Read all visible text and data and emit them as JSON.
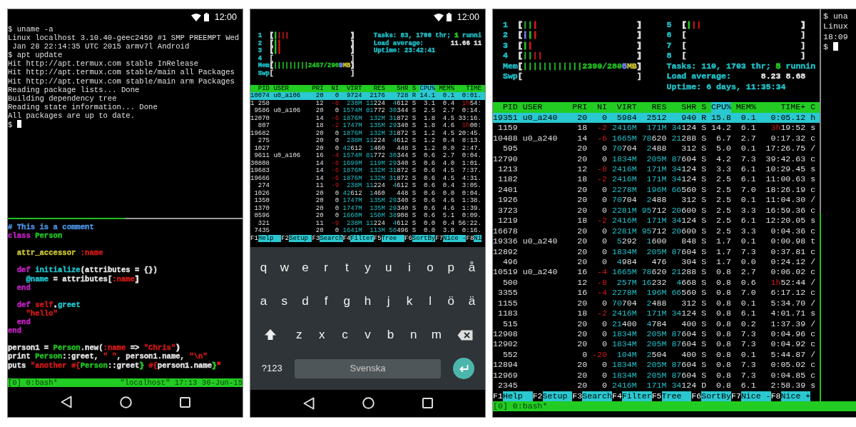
{
  "left_phone": {
    "status_bar": {
      "time": "12:00"
    },
    "shell": {
      "lines": [
        "$ uname -a",
        "Linux localhost 3.10.40-geec2459 #1 SMP PREEMPT Wed",
        " Jan 28 22:14:35 UTC 2015 armv7l Android",
        "$ apt update",
        "Hit http://apt.termux.com stable InRelease",
        "Hit http://apt.termux.com stable/main all Packages",
        "Hit http://apt.termux.com stable/main arm Packages",
        "Reading package lists... Done",
        "Building dependency tree",
        "Reading state information... Done",
        "All packages are up to date."
      ],
      "prompt": "$",
      "cursor": true
    },
    "code": [
      {
        "segments": [
          {
            "text": "# This is a comment",
            "color": "#4a90e0"
          }
        ]
      },
      {
        "segments": [
          {
            "text": "class",
            "color": "#c020c0"
          },
          {
            "text": " Person",
            "color": "#22c022"
          }
        ]
      },
      {
        "space_before": true,
        "segments": [
          {
            "text": "  attr_accessor",
            "color": "#c8c030"
          },
          {
            "text": " :name",
            "color": "#d01818"
          }
        ]
      },
      {
        "space_before": true,
        "segments": [
          {
            "text": "  def",
            "color": "#c020c0"
          },
          {
            "text": " initialize",
            "color": "#20c0c8"
          },
          {
            "text": "(attributes = {})",
            "color": "#e0e0e0"
          }
        ]
      },
      {
        "segments": [
          {
            "text": "    @name",
            "color": "#20c0c8"
          },
          {
            "text": " = attributes[",
            "color": "#e0e0e0"
          },
          {
            "text": ":name",
            "color": "#d01818"
          },
          {
            "text": "]",
            "color": "#e0e0e0"
          }
        ]
      },
      {
        "segments": [
          {
            "text": "  end",
            "color": "#c020c0"
          }
        ]
      },
      {
        "space_before": true,
        "segments": [
          {
            "text": "  def",
            "color": "#c020c0"
          },
          {
            "text": " self",
            "color": "#d01818"
          },
          {
            "text": ".",
            "color": "#e0e0e0"
          },
          {
            "text": "greet",
            "color": "#20c0c8"
          }
        ]
      },
      {
        "segments": [
          {
            "text": "    \"hello\"",
            "color": "#d01818"
          }
        ]
      },
      {
        "segments": [
          {
            "text": "  end",
            "color": "#c020c0"
          }
        ]
      },
      {
        "segments": [
          {
            "text": "end",
            "color": "#c020c0"
          }
        ]
      },
      {
        "space_before": true,
        "segments": [
          {
            "text": "person1 = ",
            "color": "#e0e0e0"
          },
          {
            "text": "Person",
            "color": "#22c022"
          },
          {
            "text": ".new(",
            "color": "#e0e0e0"
          },
          {
            "text": ":name",
            "color": "#d01818"
          },
          {
            "text": " => ",
            "color": "#e0e0e0"
          },
          {
            "text": "\"Chris\"",
            "color": "#d01818"
          },
          {
            "text": ")",
            "color": "#e0e0e0"
          }
        ]
      },
      {
        "segments": [
          {
            "text": "print ",
            "color": "#e0e0e0"
          },
          {
            "text": "Person",
            "color": "#22c022"
          },
          {
            "text": "::greet, ",
            "color": "#e0e0e0"
          },
          {
            "text": "\" \"",
            "color": "#d01818"
          },
          {
            "text": ", person1.name, ",
            "color": "#e0e0e0"
          },
          {
            "text": "\"\\n\"",
            "color": "#d01818"
          }
        ]
      },
      {
        "segments": [
          {
            "text": "puts ",
            "color": "#e0e0e0"
          },
          {
            "text": "\"another #{",
            "color": "#d01818"
          },
          {
            "text": "Person",
            "color": "#22c022"
          },
          {
            "text": "::greet",
            "color": "#e0e0e0"
          },
          {
            "text": "}",
            "color": "#22c022"
          },
          {
            "text": " #{",
            "color": "#d01818"
          },
          {
            "text": "person1.name",
            "color": "#e0e0e0"
          },
          {
            "text": "}",
            "color": "#22c022"
          },
          {
            "text": "\"",
            "color": "#d01818"
          }
        ]
      }
    ],
    "tmux_status": {
      "left": "[0] 0:bash*",
      "right": "\"localhost\" 17:13 30-Jun-15"
    }
  },
  "middle_phone": {
    "status_bar": {
      "time": "12:00"
    },
    "htop": {
      "meters_left": [
        {
          "segments": [
            {
              "text": "  1  ",
              "color": "#20c0c8"
            },
            {
              "text": "[",
              "color": "#e0e0e0"
            },
            {
              "text": "|",
              "color": "#22c022"
            },
            {
              "text": "|||",
              "color": "#d01818"
            },
            {
              "text": "                ]",
              "color": "#e0e0e0"
            }
          ]
        },
        {
          "segments": [
            {
              "text": "  2  ",
              "color": "#20c0c8"
            },
            {
              "text": "[",
              "color": "#e0e0e0"
            },
            {
              "text": "|",
              "color": "#22c022"
            },
            {
              "text": "|",
              "color": "#d01818"
            },
            {
              "text": "                  ]",
              "color": "#e0e0e0"
            }
          ]
        },
        {
          "segments": [
            {
              "text": "  3  ",
              "color": "#20c0c8"
            },
            {
              "text": "[",
              "color": "#e0e0e0"
            },
            {
              "text": "|",
              "color": "#22c022"
            },
            {
              "text": "|",
              "color": "#d01818"
            },
            {
              "text": "                  ]",
              "color": "#e0e0e0"
            }
          ]
        },
        {
          "segments": [
            {
              "text": "  4  ",
              "color": "#20c0c8"
            },
            {
              "text": "[                    ]",
              "color": "#e0e0e0"
            }
          ]
        },
        {
          "segments": [
            {
              "text": "  Mem",
              "color": "#20c0c8"
            },
            {
              "text": "[",
              "color": "#e0e0e0"
            },
            {
              "text": "|||||||||2457/296",
              "color": "#22c022"
            },
            {
              "text": "9",
              "color": "#6a7ae0"
            },
            {
              "text": "MB",
              "color": "#c8c030"
            },
            {
              "text": "]",
              "color": "#e0e0e0"
            }
          ]
        },
        {
          "segments": [
            {
              "text": "  Swp",
              "color": "#20c0c8"
            },
            {
              "text": "[                    ]",
              "color": "#e0e0e0"
            }
          ]
        }
      ],
      "meters_right": [
        {
          "segments": [
            {
              "text": "Tasks: 83, 1700 thr; ",
              "color": "#20c0c8"
            },
            {
              "text": "1",
              "color": "#22c022"
            },
            {
              "text": " runni",
              "color": "#20c0c8"
            }
          ]
        },
        {
          "segments": [
            {
              "text": "Load average: ",
              "color": "#20c0c8"
            },
            {
              "text": "      11.66 11",
              "color": "#e0e0e0"
            }
          ]
        },
        {
          "segments": [
            {
              "text": "Uptime: 23:42:41",
              "color": "#20c0c8"
            }
          ]
        }
      ],
      "columns": [
        {
          "text": "PID",
          "sorted": false
        },
        {
          "text": "USER",
          "sorted": false
        },
        {
          "text": "PRI",
          "sorted": false
        },
        {
          "text": "NI",
          "sorted": false
        },
        {
          "text": "VIRT",
          "sorted": false
        },
        {
          "text": "RES",
          "sorted": false
        },
        {
          "text": "SHR",
          "sorted": false
        },
        {
          "text": "S",
          "sorted": false
        },
        {
          "text": "CPU%",
          "sorted": true
        },
        {
          "text": "MEM%",
          "sorted": false
        },
        {
          "text": "TIME",
          "sorted": false
        }
      ],
      "rows": [
        {
          "selected": true,
          "pid": "10074",
          "user": "u0_a106",
          "pri": "20",
          "ni": "0",
          "virt": "9724",
          "res": "2176",
          "shr": "728",
          "state": "R",
          "cpu": "14.1",
          "mem": "0.1",
          "time": "0:01."
        },
        {
          "selected": false,
          "pid": "1 258",
          "pri": "12",
          "ni": {
            "alert": "-8"
          },
          "virt": {
            "hi": "238M"
          },
          "res": {
            "hi": "11",
            "text": "224"
          },
          "shr": {
            "hi": "4",
            "text": "612"
          },
          "state": "S",
          "cpu": "3.1",
          "mem": "0.4",
          "time": {
            "alert": "1h",
            "text": "54:"
          }
        },
        {
          "selected": false,
          "pid": "9586",
          "user": "u0_a106",
          "pri": "20",
          "ni": "0",
          "virt": {
            "hi": "1574M"
          },
          "res": {
            "hi": "81",
            "text": "772"
          },
          "shr": {
            "hi": "30",
            "text": "344"
          },
          "state": "S",
          "cpu": "2.5",
          "mem": "2.7",
          "time": "0:14."
        },
        {
          "selected": false,
          "pid": "12070",
          "pri": "14",
          "ni": {
            "alert": "-6"
          },
          "virt": {
            "hi": "1876M"
          },
          "res": {
            "hi": "132M"
          },
          "shr": {
            "hi": "31",
            "text": "872"
          },
          "state": "S",
          "cpu": "1.8",
          "mem": "4.5",
          "time": "33:16."
        },
        {
          "selected": false,
          "pid": "807",
          "pri": "18",
          "ni": {
            "alert": "-2"
          },
          "virt": {
            "hi": "1747M"
          },
          "res": {
            "hi": "135M"
          },
          "shr": {
            "hi": "29",
            "text": "340"
          },
          "state": "S",
          "cpu": "1.8",
          "mem": "4.6",
          "time": {
            "alert": "1h",
            "text": "00:"
          }
        },
        {
          "selected": false,
          "pid": "19682",
          "pri": "20",
          "ni": "0",
          "virt": {
            "hi": "1876M"
          },
          "res": {
            "hi": "132M"
          },
          "shr": {
            "hi": "31",
            "text": "872"
          },
          "state": "S",
          "cpu": "1.2",
          "mem": "4.5",
          "time": "20:45."
        },
        {
          "selected": false,
          "pid": "275",
          "pri": "20",
          "ni": "0",
          "virt": {
            "hi": "238M"
          },
          "res": {
            "hi": "11",
            "text": "224"
          },
          "shr": {
            "hi": "4",
            "text": "612"
          },
          "state": "S",
          "cpu": "1.2",
          "mem": "0.4",
          "time": "8:13."
        },
        {
          "selected": false,
          "pid": "1027",
          "pri": "20",
          "ni": "0",
          "virt": {
            "hi": "42",
            "text": "612"
          },
          "res": {
            "hi": "1",
            "text": "460"
          },
          "shr": "448",
          "state": "S",
          "cpu": "1.2",
          "mem": "0.0",
          "time": "2:47."
        },
        {
          "selected": false,
          "pid": "9611",
          "user": "u0_a106",
          "pri": "16",
          "ni": {
            "alert": "-4"
          },
          "virt": {
            "hi": "1574M"
          },
          "res": {
            "hi": "81",
            "text": "772"
          },
          "shr": {
            "hi": "30",
            "text": "344"
          },
          "state": "S",
          "cpu": "0.6",
          "mem": "2.7",
          "time": "0:04."
        },
        {
          "selected": false,
          "pid": "30808",
          "pri": "14",
          "ni": {
            "alert": "-6"
          },
          "virt": {
            "hi": "1699M"
          },
          "res": {
            "hi": "119M"
          },
          "shr": {
            "hi": "29",
            "text": "340"
          },
          "state": "S",
          "cpu": "0.6",
          "mem": "4.0",
          "time": "1:01."
        },
        {
          "selected": false,
          "pid": "19683",
          "pri": "14",
          "ni": {
            "alert": "-6"
          },
          "virt": {
            "hi": "1876M"
          },
          "res": {
            "hi": "132M"
          },
          "shr": {
            "hi": "31",
            "text": "872"
          },
          "state": "S",
          "cpu": "0.6",
          "mem": "4.5",
          "time": "7:37."
        },
        {
          "selected": false,
          "pid": "19666",
          "pri": "14",
          "ni": {
            "alert": "-6"
          },
          "virt": {
            "hi": "1876M"
          },
          "res": {
            "hi": "132M"
          },
          "shr": {
            "hi": "31",
            "text": "872"
          },
          "state": "S",
          "cpu": "0.6",
          "mem": "4.5",
          "time": "4:31."
        },
        {
          "selected": false,
          "pid": "274",
          "pri": "11",
          "ni": {
            "alert": "-9"
          },
          "virt": {
            "hi": "238M"
          },
          "res": {
            "hi": "11",
            "text": "224"
          },
          "shr": {
            "hi": "4",
            "text": "612"
          },
          "state": "S",
          "cpu": "0.6",
          "mem": "0.4",
          "time": "3:05."
        },
        {
          "selected": false,
          "pid": "1026",
          "pri": "20",
          "ni": "0",
          "virt": {
            "hi": "42",
            "text": "612"
          },
          "res": {
            "hi": "1",
            "text": "460"
          },
          "shr": "448",
          "state": "S",
          "cpu": "0.6",
          "mem": "0.0",
          "time": "0:04."
        },
        {
          "selected": false,
          "pid": "1350",
          "pri": "20",
          "ni": "0",
          "virt": {
            "hi": "1747M"
          },
          "res": {
            "hi": "135M"
          },
          "shr": {
            "hi": "29",
            "text": "340"
          },
          "state": "S",
          "cpu": "0.6",
          "mem": "4.6",
          "time": "1:38."
        },
        {
          "selected": false,
          "pid": "1370",
          "pri": "20",
          "ni": "0",
          "virt": {
            "hi": "1747M"
          },
          "res": {
            "hi": "135M"
          },
          "shr": {
            "hi": "29",
            "text": "340"
          },
          "state": "S",
          "cpu": "0.6",
          "mem": "4.6",
          "time": "1:39."
        },
        {
          "selected": false,
          "pid": "8596",
          "pri": "20",
          "ni": "0",
          "virt": {
            "hi": "1660M"
          },
          "res": {
            "hi": "150M"
          },
          "shr": {
            "hi": "38",
            "text": "908"
          },
          "state": "S",
          "cpu": "0.6",
          "mem": "5.1",
          "time": "0:09."
        },
        {
          "selected": false,
          "pid": "321",
          "pri": "11",
          "ni": {
            "alert": "-9"
          },
          "virt": {
            "hi": "238M"
          },
          "res": {
            "hi": "11",
            "text": "224"
          },
          "shr": {
            "hi": "4",
            "text": "612"
          },
          "state": "S",
          "cpu": "0.0",
          "mem": "0.4",
          "time": "56:22."
        },
        {
          "selected": false,
          "pid": "7435",
          "pri": "20",
          "ni": "0",
          "virt": {
            "hi": "1641M"
          },
          "res": {
            "hi": "113M"
          },
          "shr": {
            "hi": "50",
            "text": "496"
          },
          "state": "S",
          "cpu": "0.0",
          "mem": "3.8",
          "time": "0:16."
        }
      ],
      "function_keys": [
        {
          "key": "F1",
          "label": "Help"
        },
        {
          "key": "F2",
          "label": "Setup"
        },
        {
          "key": "F3",
          "label": "Search"
        },
        {
          "key": "F4",
          "label": "Filter"
        },
        {
          "key": "F5",
          "label": "Tree"
        },
        {
          "key": "F6",
          "label": "SortBy"
        },
        {
          "key": "F7",
          "label": "Nice -"
        },
        {
          "key": "F8",
          "label": "Ni"
        }
      ]
    },
    "keyboard": {
      "letter_rows": [
        [
          "q",
          "w",
          "e",
          "r",
          "t",
          "y",
          "u",
          "i",
          "o",
          "p",
          "å"
        ],
        [
          "a",
          "s",
          "d",
          "f",
          "g",
          "h",
          "j",
          "k",
          "l",
          "ö",
          "ä"
        ],
        [
          "z",
          "x",
          "c",
          "v",
          "b",
          "n",
          "m"
        ]
      ],
      "mode_key": "?123",
      "space_label": "Svenska"
    }
  },
  "right_terminal": {
    "htop": {
      "meters_left": [
        {
          "segments": [
            {
              "text": "  1  ",
              "color": "#20c0c8"
            },
            {
              "text": "[",
              "color": "#e0e0e0"
            },
            {
              "text": "||",
              "color": "#22c022"
            },
            {
              "text": "|",
              "color": "#d01818"
            },
            {
              "text": "                    ]",
              "color": "#e0e0e0"
            }
          ]
        },
        {
          "segments": [
            {
              "text": "  2  ",
              "color": "#20c0c8"
            },
            {
              "text": "[",
              "color": "#e0e0e0"
            },
            {
              "text": "|",
              "color": "#6a7ae0"
            },
            {
              "text": "|",
              "color": "#22c022"
            },
            {
              "text": "|",
              "color": "#d01818"
            },
            {
              "text": "                    ]",
              "color": "#e0e0e0"
            }
          ]
        },
        {
          "segments": [
            {
              "text": "  3  ",
              "color": "#20c0c8"
            },
            {
              "text": "[",
              "color": "#e0e0e0"
            },
            {
              "text": "|",
              "color": "#22c022"
            },
            {
              "text": "|",
              "color": "#d01818"
            },
            {
              "text": "                     ]",
              "color": "#e0e0e0"
            }
          ]
        },
        {
          "segments": [
            {
              "text": "  4  ",
              "color": "#20c0c8"
            },
            {
              "text": "[",
              "color": "#e0e0e0"
            },
            {
              "text": "||",
              "color": "#22c022"
            },
            {
              "text": "||",
              "color": "#d01818"
            },
            {
              "text": "                   ]",
              "color": "#e0e0e0"
            }
          ]
        },
        {
          "segments": [
            {
              "text": "  Mem",
              "color": "#20c0c8"
            },
            {
              "text": "[",
              "color": "#e0e0e0"
            },
            {
              "text": "||||||||||||2390/280",
              "color": "#22c022"
            },
            {
              "text": "5",
              "color": "#6a7ae0"
            },
            {
              "text": "MB",
              "color": "#c8c030"
            },
            {
              "text": "]",
              "color": "#e0e0e0"
            }
          ]
        },
        {
          "segments": [
            {
              "text": "  Swp",
              "color": "#20c0c8"
            },
            {
              "text": "[                       ]",
              "color": "#e0e0e0"
            }
          ]
        }
      ],
      "meters_right": [
        {
          "segments": [
            {
              "text": "5  ",
              "color": "#20c0c8"
            },
            {
              "text": "[",
              "color": "#e0e0e0"
            },
            {
              "text": "|",
              "color": "#22c022"
            },
            {
              "text": "||",
              "color": "#d01818"
            },
            {
              "text": "                    ]",
              "color": "#e0e0e0"
            }
          ]
        },
        {
          "segments": [
            {
              "text": "6  ",
              "color": "#20c0c8"
            },
            {
              "text": "[                       ]",
              "color": "#e0e0e0"
            }
          ]
        },
        {
          "segments": [
            {
              "text": "7  ",
              "color": "#20c0c8"
            },
            {
              "text": "[                       ]",
              "color": "#e0e0e0"
            }
          ]
        },
        {
          "segments": [
            {
              "text": "8  ",
              "color": "#20c0c8"
            },
            {
              "text": "[                       ]",
              "color": "#e0e0e0"
            }
          ]
        },
        {
          "segments": [
            {
              "text": "Tasks: 110, 1703 thr; ",
              "color": "#20c0c8"
            },
            {
              "text": "5",
              "color": "#22c022"
            },
            {
              "text": " runnin",
              "color": "#20c0c8"
            }
          ]
        },
        {
          "segments": [
            {
              "text": "Load average: ",
              "color": "#20c0c8"
            },
            {
              "text": "     8.23 8.68",
              "color": "#e0e0e0"
            }
          ]
        },
        {
          "segments": [
            {
              "text": "Uptime: 6 days, 11:35:34",
              "color": "#20c0c8"
            }
          ]
        }
      ],
      "columns": [
        {
          "text": "PID",
          "sorted": false
        },
        {
          "text": "USER",
          "sorted": false
        },
        {
          "text": "PRI",
          "sorted": false
        },
        {
          "text": "NI",
          "sorted": false
        },
        {
          "text": "VIRT",
          "sorted": false
        },
        {
          "text": "RES",
          "sorted": false
        },
        {
          "text": "SHR",
          "sorted": false
        },
        {
          "text": "S",
          "sorted": false
        },
        {
          "text": "CPU%",
          "sorted": true
        },
        {
          "text": "MEM%",
          "sorted": false
        },
        {
          "text": "TIME+",
          "sorted": false
        },
        {
          "text": "C",
          "sorted": false
        }
      ],
      "rows": [
        {
          "selected": true,
          "pid": "19351",
          "user": "u0_a240",
          "pri": "20",
          "ni": "0",
          "virt": "5984",
          "res": "2512",
          "shr": "940",
          "state": "R",
          "cpu": "15.8",
          "mem": "0.1",
          "time": "0:05.12",
          "command": "h"
        },
        {
          "selected": false,
          "pid": "1159",
          "pri": "18",
          "ni": {
            "alert": "-2"
          },
          "virt": {
            "hi": "2416M"
          },
          "res": {
            "hi": "171M"
          },
          "shr": {
            "hi": "34",
            "text": "124"
          },
          "state": "S",
          "cpu": "14.2",
          "mem": "6.1",
          "time": {
            "alert": "3h",
            "text": "19:52"
          },
          "command": "s"
        },
        {
          "selected": false,
          "pid": "10488",
          "user": "u0_a240",
          "pri": "14",
          "ni": {
            "alert": "-6"
          },
          "virt": {
            "hi": "1665M"
          },
          "res": {
            "hi": "78",
            "text": "620"
          },
          "shr": {
            "hi": "21",
            "text": "288"
          },
          "state": "S",
          "cpu": "6.7",
          "mem": "2.7",
          "time": "0:17.32",
          "command": "c"
        },
        {
          "selected": false,
          "pid": "595",
          "pri": "20",
          "ni": "0",
          "virt": {
            "hi": "70",
            "text": "704"
          },
          "res": {
            "hi": "2",
            "text": "488"
          },
          "shr": "312",
          "state": "S",
          "cpu": "5.0",
          "mem": "0.1",
          "time": "17:26.75",
          "command": "/"
        },
        {
          "selected": false,
          "pid": "12790",
          "pri": "20",
          "ni": "0",
          "virt": {
            "hi": "1834M"
          },
          "res": {
            "hi": "205M"
          },
          "shr": {
            "hi": "87",
            "text": "604"
          },
          "state": "S",
          "cpu": "4.2",
          "mem": "7.3",
          "time": "39:42.63",
          "command": "c"
        },
        {
          "selected": false,
          "pid": "1213",
          "pri": "12",
          "ni": {
            "alert": "-8"
          },
          "virt": {
            "hi": "2416M"
          },
          "res": {
            "hi": "171M"
          },
          "shr": {
            "hi": "34",
            "text": "124"
          },
          "state": "S",
          "cpu": "3.3",
          "mem": "6.1",
          "time": "10:29.45",
          "command": "s"
        },
        {
          "selected": false,
          "pid": "1182",
          "pri": "18",
          "ni": {
            "alert": "-2"
          },
          "virt": {
            "hi": "2416M"
          },
          "res": {
            "hi": "171M"
          },
          "shr": {
            "hi": "34",
            "text": "124"
          },
          "state": "S",
          "cpu": "2.5",
          "mem": "6.1",
          "time": "11:00.63",
          "command": "s"
        },
        {
          "selected": false,
          "pid": "2401",
          "pri": "20",
          "ni": "0",
          "virt": {
            "hi": "2278M"
          },
          "res": {
            "hi": "196M"
          },
          "shr": {
            "hi": "66",
            "text": "560"
          },
          "state": "S",
          "cpu": "2.5",
          "mem": "7.0",
          "time": "18:26.19",
          "command": "c"
        },
        {
          "selected": false,
          "pid": "1926",
          "pri": "20",
          "ni": "0",
          "virt": {
            "hi": "70",
            "text": "704"
          },
          "res": {
            "hi": "2",
            "text": "488"
          },
          "shr": "312",
          "state": "S",
          "cpu": "2.5",
          "mem": "0.1",
          "time": "11:04.30",
          "command": "/"
        },
        {
          "selected": false,
          "pid": "3723",
          "pri": "20",
          "ni": "0",
          "virt": {
            "hi": "2281M"
          },
          "res": {
            "hi": "95",
            "text": "712"
          },
          "shr": {
            "hi": "20",
            "text": "600"
          },
          "state": "S",
          "cpu": "2.5",
          "mem": "3.3",
          "time": "16:59.36",
          "command": "c"
        },
        {
          "selected": false,
          "pid": "1219",
          "pri": "18",
          "ni": {
            "alert": "-2"
          },
          "virt": {
            "hi": "2416M"
          },
          "res": {
            "hi": "171M"
          },
          "shr": {
            "hi": "34",
            "text": "124"
          },
          "state": "S",
          "cpu": "2.5",
          "mem": "6.1",
          "time": "12:20.05",
          "command": "s"
        },
        {
          "selected": false,
          "pid": "16678",
          "pri": "20",
          "ni": "0",
          "virt": {
            "hi": "2281M"
          },
          "res": {
            "hi": "95",
            "text": "712"
          },
          "shr": {
            "hi": "20",
            "text": "600"
          },
          "state": "S",
          "cpu": "2.5",
          "mem": "3.3",
          "time": "0:04.36",
          "command": "c"
        },
        {
          "selected": false,
          "pid": "19336",
          "user": "u0_a240",
          "pri": "20",
          "ni": "0",
          "virt": {
            "hi": "5",
            "text": "292"
          },
          "res": {
            "hi": "1",
            "text": "600"
          },
          "shr": "848",
          "state": "S",
          "cpu": "1.7",
          "mem": "0.1",
          "time": "0:00.98",
          "command": "t"
        },
        {
          "selected": false,
          "pid": "12892",
          "pri": "20",
          "ni": "0",
          "virt": {
            "hi": "1834M"
          },
          "res": {
            "hi": "205M"
          },
          "shr": {
            "hi": "87",
            "text": "604"
          },
          "state": "S",
          "cpu": "1.7",
          "mem": "7.3",
          "time": "0:37.81",
          "command": "c"
        },
        {
          "selected": false,
          "pid": "496",
          "pri": "20",
          "ni": "0",
          "virt": {
            "hi": "4",
            "text": "984"
          },
          "res": "476",
          "shr": "304",
          "state": "S",
          "cpu": "1.7",
          "mem": "0.0",
          "time": "0:24.12",
          "command": "/"
        },
        {
          "selected": false,
          "pid": "10519",
          "user": "u0_a240",
          "pri": "16",
          "ni": {
            "alert": "-4"
          },
          "virt": {
            "hi": "1665M"
          },
          "res": {
            "hi": "78",
            "text": "620"
          },
          "shr": {
            "hi": "21",
            "text": "288"
          },
          "state": "S",
          "cpu": "0.8",
          "mem": "2.7",
          "time": "0:06.02",
          "command": "c"
        },
        {
          "selected": false,
          "pid": "500",
          "pri": "12",
          "ni": {
            "alert": "-8"
          },
          "virt": {
            "hi": "257M"
          },
          "res": {
            "hi": "16",
            "text": "232"
          },
          "shr": {
            "hi": "4",
            "text": "668"
          },
          "state": "S",
          "cpu": "0.8",
          "mem": "0.6",
          "time": {
            "alert": "1h",
            "text": "52:44"
          },
          "command": "/"
        },
        {
          "selected": false,
          "pid": "3355",
          "pri": "16",
          "ni": {
            "alert": "-4"
          },
          "virt": {
            "hi": "2278M"
          },
          "res": {
            "hi": "196M"
          },
          "shr": {
            "hi": "66",
            "text": "560"
          },
          "state": "S",
          "cpu": "0.8",
          "mem": "7.0",
          "time": "6:17.12",
          "command": "c"
        },
        {
          "selected": false,
          "pid": "1155",
          "pri": "20",
          "ni": "0",
          "virt": {
            "hi": "70",
            "text": "704"
          },
          "res": {
            "hi": "2",
            "text": "488"
          },
          "shr": "312",
          "state": "S",
          "cpu": "0.8",
          "mem": "0.1",
          "time": "5:34.70",
          "command": "/"
        },
        {
          "selected": false,
          "pid": "1183",
          "pri": "18",
          "ni": {
            "alert": "-2"
          },
          "virt": {
            "hi": "2416M"
          },
          "res": {
            "hi": "171M"
          },
          "shr": {
            "hi": "34",
            "text": "124"
          },
          "state": "S",
          "cpu": "0.8",
          "mem": "6.1",
          "time": "4:01.71",
          "command": "s"
        },
        {
          "selected": false,
          "pid": "515",
          "pri": "20",
          "ni": "0",
          "virt": {
            "hi": "21",
            "text": "400"
          },
          "res": {
            "hi": "4",
            "text": "784"
          },
          "shr": "400",
          "state": "S",
          "cpu": "0.8",
          "mem": "0.2",
          "time": "1:37.39",
          "command": "/"
        },
        {
          "selected": false,
          "pid": "12908",
          "pri": "20",
          "ni": "0",
          "virt": {
            "hi": "1834M"
          },
          "res": {
            "hi": "205M"
          },
          "shr": {
            "hi": "87",
            "text": "604"
          },
          "state": "S",
          "cpu": "0.8",
          "mem": "7.3",
          "time": "0:04.96",
          "command": "c"
        },
        {
          "selected": false,
          "pid": "12902",
          "pri": "20",
          "ni": "0",
          "virt": {
            "hi": "1834M"
          },
          "res": {
            "hi": "205M"
          },
          "shr": {
            "hi": "87",
            "text": "604"
          },
          "state": "S",
          "cpu": "0.8",
          "mem": "7.3",
          "time": "0:04.92",
          "command": "c"
        },
        {
          "selected": false,
          "pid": "552",
          "pri": "0",
          "ni": {
            "alert": "-20"
          },
          "virt": {
            "hi": "104M"
          },
          "res": {
            "hi": "2",
            "text": "504"
          },
          "shr": "400",
          "state": "S",
          "cpu": "0.8",
          "mem": "0.1",
          "time": "5:44.87",
          "command": "/"
        },
        {
          "selected": false,
          "pid": "12894",
          "pri": "20",
          "ni": "0",
          "virt": {
            "hi": "1834M"
          },
          "res": {
            "hi": "205M"
          },
          "shr": {
            "hi": "87",
            "text": "604"
          },
          "state": "S",
          "cpu": "0.8",
          "mem": "7.3",
          "time": "0:05.02",
          "command": "c"
        },
        {
          "selected": false,
          "pid": "12969",
          "pri": "20",
          "ni": "0",
          "virt": {
            "hi": "1834M"
          },
          "res": {
            "hi": "205M"
          },
          "shr": {
            "hi": "87",
            "text": "604"
          },
          "state": "S",
          "cpu": "0.8",
          "mem": "7.3",
          "time": "0:04.85",
          "command": "c"
        },
        {
          "selected": false,
          "pid": "2345",
          "pri": "20",
          "ni": "0",
          "virt": {
            "hi": "2416M"
          },
          "res": {
            "hi": "171M"
          },
          "shr": {
            "hi": "34",
            "text": "124"
          },
          "state": "D",
          "cpu": "0.8",
          "mem": "6.1",
          "time": "2:58.39",
          "command": "s"
        }
      ],
      "function_keys": [
        {
          "key": "F1",
          "label": "Help"
        },
        {
          "key": "F2",
          "label": "Setup"
        },
        {
          "key": "F3",
          "label": "Search"
        },
        {
          "key": "F4",
          "label": "Filter"
        },
        {
          "key": "F5",
          "label": "Tree"
        },
        {
          "key": "F6",
          "label": "SortBy"
        },
        {
          "key": "F7",
          "label": "Nice -"
        },
        {
          "key": "F8",
          "label": "Nice +"
        }
      ]
    },
    "side_shell": {
      "lines": [
        "$ una",
        "Linux",
        "18:09"
      ],
      "prompt": "$",
      "cursor": true
    },
    "tmux_status": {
      "left": "[0] 0:bash*"
    }
  }
}
